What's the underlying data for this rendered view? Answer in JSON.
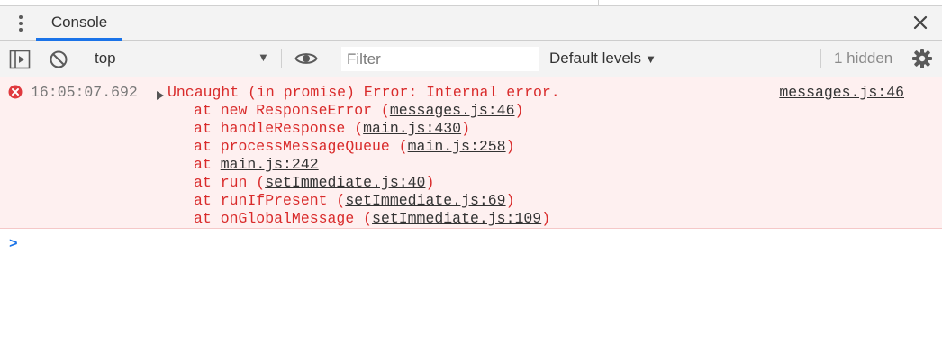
{
  "tabs": {
    "console_label": "Console"
  },
  "toolbar": {
    "context": "top",
    "filter_placeholder": "Filter",
    "levels_label": "Default levels",
    "hidden_count": "1 hidden"
  },
  "error": {
    "timestamp": "16:05:07.692",
    "message": "Uncaught (in promise) Error: Internal error.",
    "source": "messages.js:46",
    "stack": [
      {
        "prefix": "at new ResponseError (",
        "link": "messages.js:46",
        "suffix": ")"
      },
      {
        "prefix": "at handleResponse (",
        "link": "main.js:430",
        "suffix": ")"
      },
      {
        "prefix": "at processMessageQueue (",
        "link": "main.js:258",
        "suffix": ")"
      },
      {
        "prefix": "at ",
        "link": "main.js:242",
        "suffix": ""
      },
      {
        "prefix": "at run (",
        "link": "setImmediate.js:40",
        "suffix": ")"
      },
      {
        "prefix": "at runIfPresent (",
        "link": "setImmediate.js:69",
        "suffix": ")"
      },
      {
        "prefix": "at onGlobalMessage (",
        "link": "setImmediate.js:109",
        "suffix": ")"
      }
    ]
  },
  "colors": {
    "accent": "#1a73e8",
    "error_text": "#d92b2b",
    "error_bg": "#fef0f0",
    "toolbar_bg": "#f3f3f3"
  },
  "icons": [
    "more-vert-icon",
    "close-icon",
    "sidebar-toggle-icon",
    "clear-console-icon",
    "eye-icon",
    "gear-icon",
    "error-icon",
    "expand-triangle-icon",
    "prompt-chevron-icon"
  ]
}
